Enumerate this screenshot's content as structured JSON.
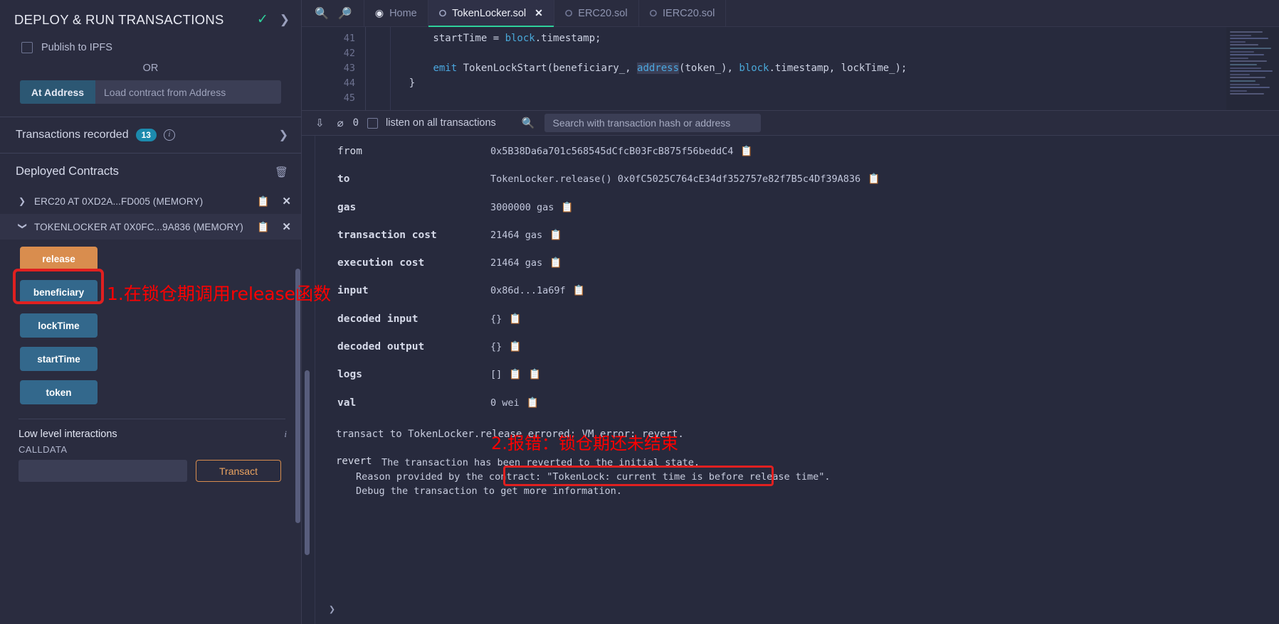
{
  "sidebar": {
    "title": "DEPLOY & RUN TRANSACTIONS",
    "check_icon": "check-icon",
    "expand_icon": "chevron-right-icon",
    "publish_ipfs_label": "Publish to IPFS",
    "or_label": "OR",
    "at_address_button": "At Address",
    "at_address_placeholder": "Load contract from Address",
    "transactions_recorded_label": "Transactions recorded",
    "transactions_recorded_count": "13",
    "deployed_contracts_label": "Deployed Contracts",
    "contracts": [
      {
        "name": "ERC20 AT 0XD2A...FD005 (MEMORY)",
        "expanded": false
      },
      {
        "name": "TOKENLOCKER AT 0X0FC...9A836 (MEMORY)",
        "expanded": true
      }
    ],
    "functions": [
      {
        "label": "release",
        "kind": "transact"
      },
      {
        "label": "beneficiary",
        "kind": "call"
      },
      {
        "label": "lockTime",
        "kind": "call"
      },
      {
        "label": "startTime",
        "kind": "call"
      },
      {
        "label": "token",
        "kind": "call"
      }
    ],
    "low_level_title": "Low level interactions",
    "calldata_label": "CALLDATA",
    "calldata_value": "",
    "transact_button": "Transact"
  },
  "tabs": {
    "zoom_out_icon": "zoom-out-icon",
    "zoom_in_icon": "zoom-in-icon",
    "items": [
      {
        "label": "Home",
        "icon": "home-icon",
        "active": false,
        "closable": false
      },
      {
        "label": "TokenLocker.sol",
        "icon": "solidity-icon",
        "active": true,
        "closable": true
      },
      {
        "label": "ERC20.sol",
        "icon": "solidity-icon",
        "active": false,
        "closable": false
      },
      {
        "label": "IERC20.sol",
        "icon": "solidity-icon",
        "active": false,
        "closable": false
      }
    ]
  },
  "editor": {
    "lines": [
      {
        "number": "41",
        "text": "startTime = block.timestamp;"
      },
      {
        "number": "42",
        "text": ""
      },
      {
        "number": "43",
        "text": "emit TokenLockStart(beneficiary_, address(token_), block.timestamp, lockTime_);"
      },
      {
        "number": "44",
        "text": "}"
      },
      {
        "number": "45",
        "text": ""
      }
    ]
  },
  "terminal_toolbar": {
    "collapse_icon": "chevrons-down-icon",
    "clear_icon": "ban-icon",
    "pending_count": "0",
    "listen_label": "listen on all transactions",
    "search_icon": "search-icon",
    "search_placeholder": "Search with transaction hash or address",
    "search_value": ""
  },
  "transaction": {
    "rows": [
      {
        "key": "from",
        "value": "0x5B38Da6a701c568545dCfcB03FcB875f56beddC4",
        "copies": 1
      },
      {
        "key": "to",
        "value": "TokenLocker.release() 0x0fC5025C764cE34df352757e82f7B5c4Df39A836",
        "copies": 1
      },
      {
        "key": "gas",
        "value": "3000000 gas",
        "copies": 1
      },
      {
        "key": "transaction cost",
        "value": "21464 gas",
        "copies": 1
      },
      {
        "key": "execution cost",
        "value": "21464 gas",
        "copies": 1
      },
      {
        "key": "input",
        "value": "0x86d...1a69f",
        "copies": 1
      },
      {
        "key": "decoded input",
        "value": "{}",
        "copies": 1
      },
      {
        "key": "decoded output",
        "value": "{}",
        "copies": 1
      },
      {
        "key": "logs",
        "value": "[]",
        "copies": 2
      },
      {
        "key": "val",
        "value": "0 wei",
        "copies": 1
      }
    ],
    "error_line": "transact to TokenLocker.release errored: VM error: revert.",
    "revert_label": "revert",
    "revert_line1": "The transaction has been reverted to the initial state.",
    "revert_line2_prefix": "Reason provided by the contract:",
    "revert_line2_quote": "\"TokenLock: current time is before release time\".",
    "revert_line3": "Debug the transaction to get more information."
  },
  "annotations": {
    "note1": "1.在锁仓期调用release函数",
    "note2": "2.报错：锁仓期还未结束",
    "color": "#ff0000"
  }
}
